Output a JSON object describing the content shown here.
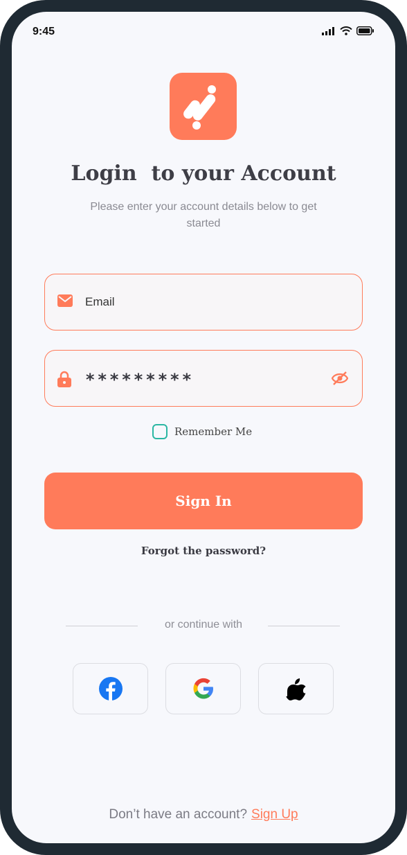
{
  "status_bar": {
    "time": "9:45"
  },
  "header": {
    "title": "Login  to your Account",
    "subtitle": "Please enter your account details below to get started"
  },
  "form": {
    "email_placeholder": "Email",
    "password_value": "*********",
    "remember_label": "Remember Me",
    "sign_in_label": "Sign In",
    "forgot_label": "Forgot the password?"
  },
  "social": {
    "divider_text": "or continue with",
    "providers": [
      "facebook-icon",
      "google-icon",
      "apple-icon"
    ]
  },
  "footer": {
    "prompt": "Don’t have an account?",
    "signup_label": "Sign Up"
  },
  "colors": {
    "accent": "#ff7b5a",
    "checkbox": "#2bb7a3",
    "background": "#f7f8fc",
    "frame": "#1f2a33"
  }
}
